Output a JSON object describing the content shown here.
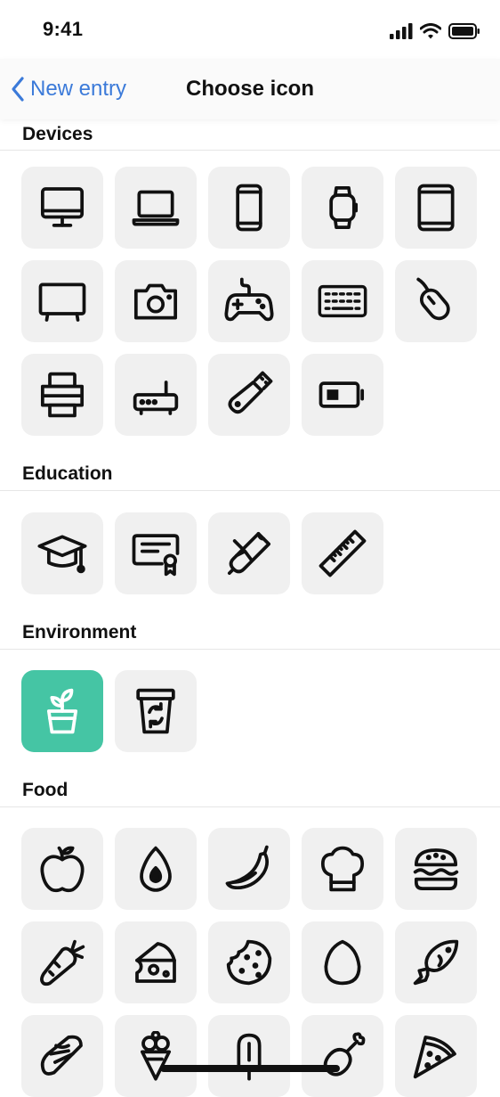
{
  "status_bar": {
    "time": "9:41"
  },
  "nav": {
    "back_label": "New entry",
    "title": "Choose icon"
  },
  "sections": [
    {
      "title": "Devices",
      "icons": [
        "desktop-icon",
        "laptop-icon",
        "smartphone-icon",
        "smartwatch-icon",
        "tablet-icon",
        "tv-icon",
        "camera-icon",
        "gamepad-icon",
        "keyboard-icon",
        "mouse-icon",
        "printer-icon",
        "router-icon",
        "usb-drive-icon",
        "battery-icon"
      ]
    },
    {
      "title": "Education",
      "icons": [
        "graduation-cap-icon",
        "certificate-icon",
        "diploma-icon",
        "ruler-icon"
      ]
    },
    {
      "title": "Environment",
      "icons": [
        "plant-pot-icon",
        "recycling-bin-icon"
      ]
    },
    {
      "title": "Food",
      "icons": [
        "apple-icon",
        "avocado-icon",
        "banana-icon",
        "chef-hat-icon",
        "burger-icon",
        "carrot-icon",
        "cheese-icon",
        "cookie-icon",
        "egg-icon",
        "fish-icon",
        "hot-dog-icon",
        "ice-cream-icon",
        "popsicle-icon",
        "drumstick-icon",
        "pizza-icon"
      ]
    }
  ],
  "selected_icon": "plant-pot-icon",
  "colors": {
    "accent": "#3b7ad9",
    "selected_tile": "#45c5a4",
    "tile_bg": "#f0f0f0"
  }
}
